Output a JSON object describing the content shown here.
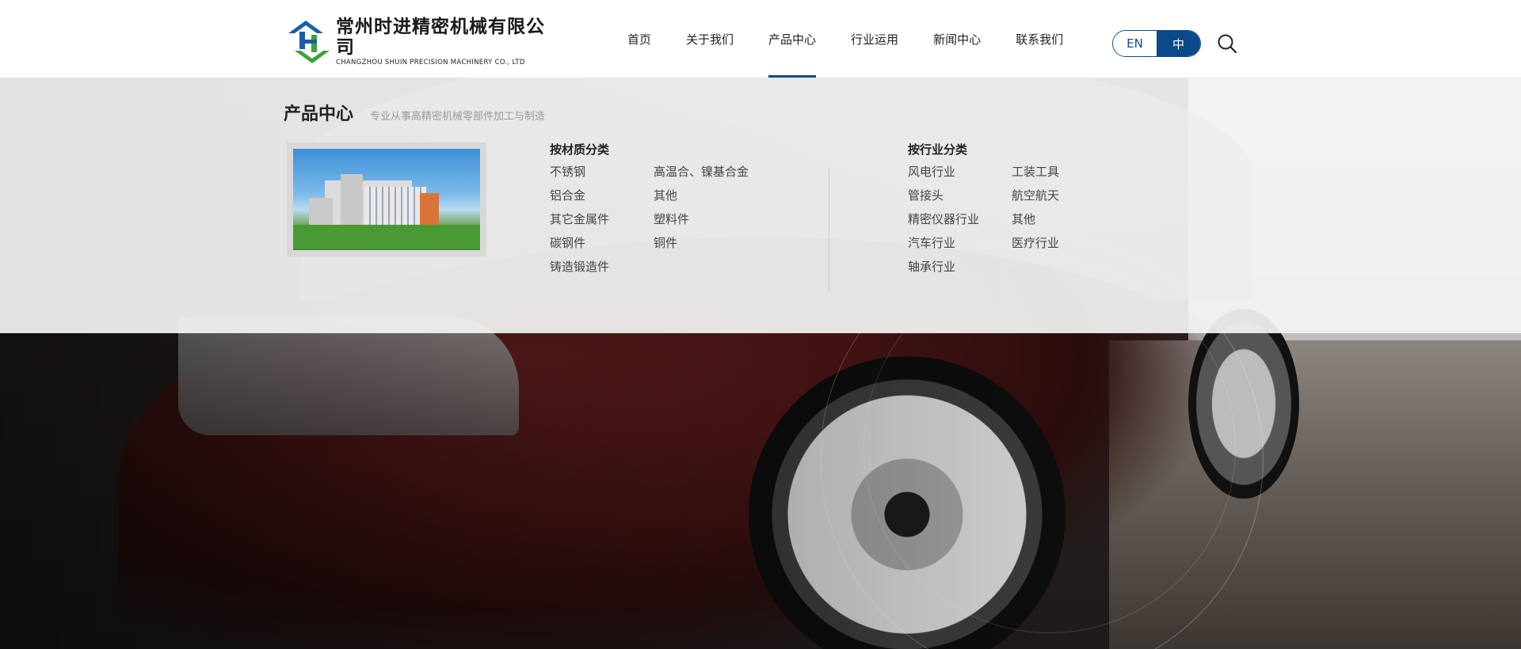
{
  "logo": {
    "name_cn": "常州时进精密机械有限公司",
    "name_en": "CHANGZHOU SHUIN PRECISION MACHINERY CO., LTD"
  },
  "nav": {
    "items": [
      {
        "label": "首页"
      },
      {
        "label": "关于我们"
      },
      {
        "label": "产品中心"
      },
      {
        "label": "行业运用"
      },
      {
        "label": "新闻中心"
      },
      {
        "label": "联系我们"
      }
    ],
    "active_index": 2
  },
  "lang": {
    "en": "EN",
    "cn": "中",
    "active": "中"
  },
  "icons": {
    "search": "search-icon"
  },
  "colors": {
    "accent": "#0a4a8a",
    "logo_blue": "#1a5da8",
    "logo_green": "#3aa33a"
  },
  "mega": {
    "title": "产品中心",
    "subtitle": "专业从事高精密机械零部件加工与制造",
    "by_material": {
      "title": "按材质分类",
      "items": [
        "不锈钢",
        "高温合、镍基合金",
        "铝合金",
        "其他",
        "其它金属件",
        "塑料件",
        "碳钢件",
        "铜件",
        "铸造锻造件"
      ]
    },
    "by_industry": {
      "title": "按行业分类",
      "items": [
        "风电行业",
        "工装工具",
        "管接头",
        "航空航天",
        "精密仪器行业",
        "其他",
        "汽车行业",
        "医疗行业",
        "轴承行业"
      ]
    }
  }
}
